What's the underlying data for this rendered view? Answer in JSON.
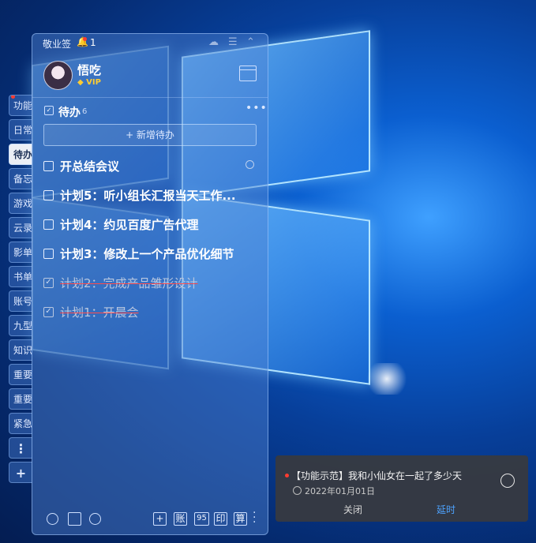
{
  "app": {
    "title": "敬业签",
    "notification_count": "1"
  },
  "user": {
    "name": "悟吃",
    "badge": "VIP"
  },
  "side_tabs": [
    {
      "label": "功能"
    },
    {
      "label": "日常"
    },
    {
      "label": "待办",
      "active": true
    },
    {
      "label": "备忘"
    },
    {
      "label": "游戏"
    },
    {
      "label": "云录"
    },
    {
      "label": "影单"
    },
    {
      "label": "书单"
    },
    {
      "label": "账号"
    },
    {
      "label": "九型"
    },
    {
      "label": "知识"
    },
    {
      "label": "重要"
    },
    {
      "label": "重要"
    },
    {
      "label": "紧急"
    },
    {
      "label": "⋮"
    },
    {
      "label": "+"
    }
  ],
  "section": {
    "title": "待办",
    "count": "6",
    "add_label": "+ 新增待办"
  },
  "tasks": [
    {
      "text": "开总结会议",
      "done": false,
      "has_reminder": true
    },
    {
      "text": "计划5：听小组长汇报当天工作...",
      "done": false
    },
    {
      "text": "计划4：约见百度广告代理",
      "done": false
    },
    {
      "text": "计划3：修改上一个产品优化细节",
      "done": false
    },
    {
      "text": "计划2：完成产品雏形设计",
      "done": true
    },
    {
      "text": "计划1：开晨会",
      "done": true
    }
  ],
  "bottom_toolbar": {
    "buttons": [
      "+",
      "账",
      "95",
      "印",
      "算"
    ]
  },
  "notification": {
    "title": "【功能示范】我和小仙女在一起了多少天",
    "date": "2022年01月01日",
    "close_label": "关闭",
    "delay_label": "延时"
  }
}
